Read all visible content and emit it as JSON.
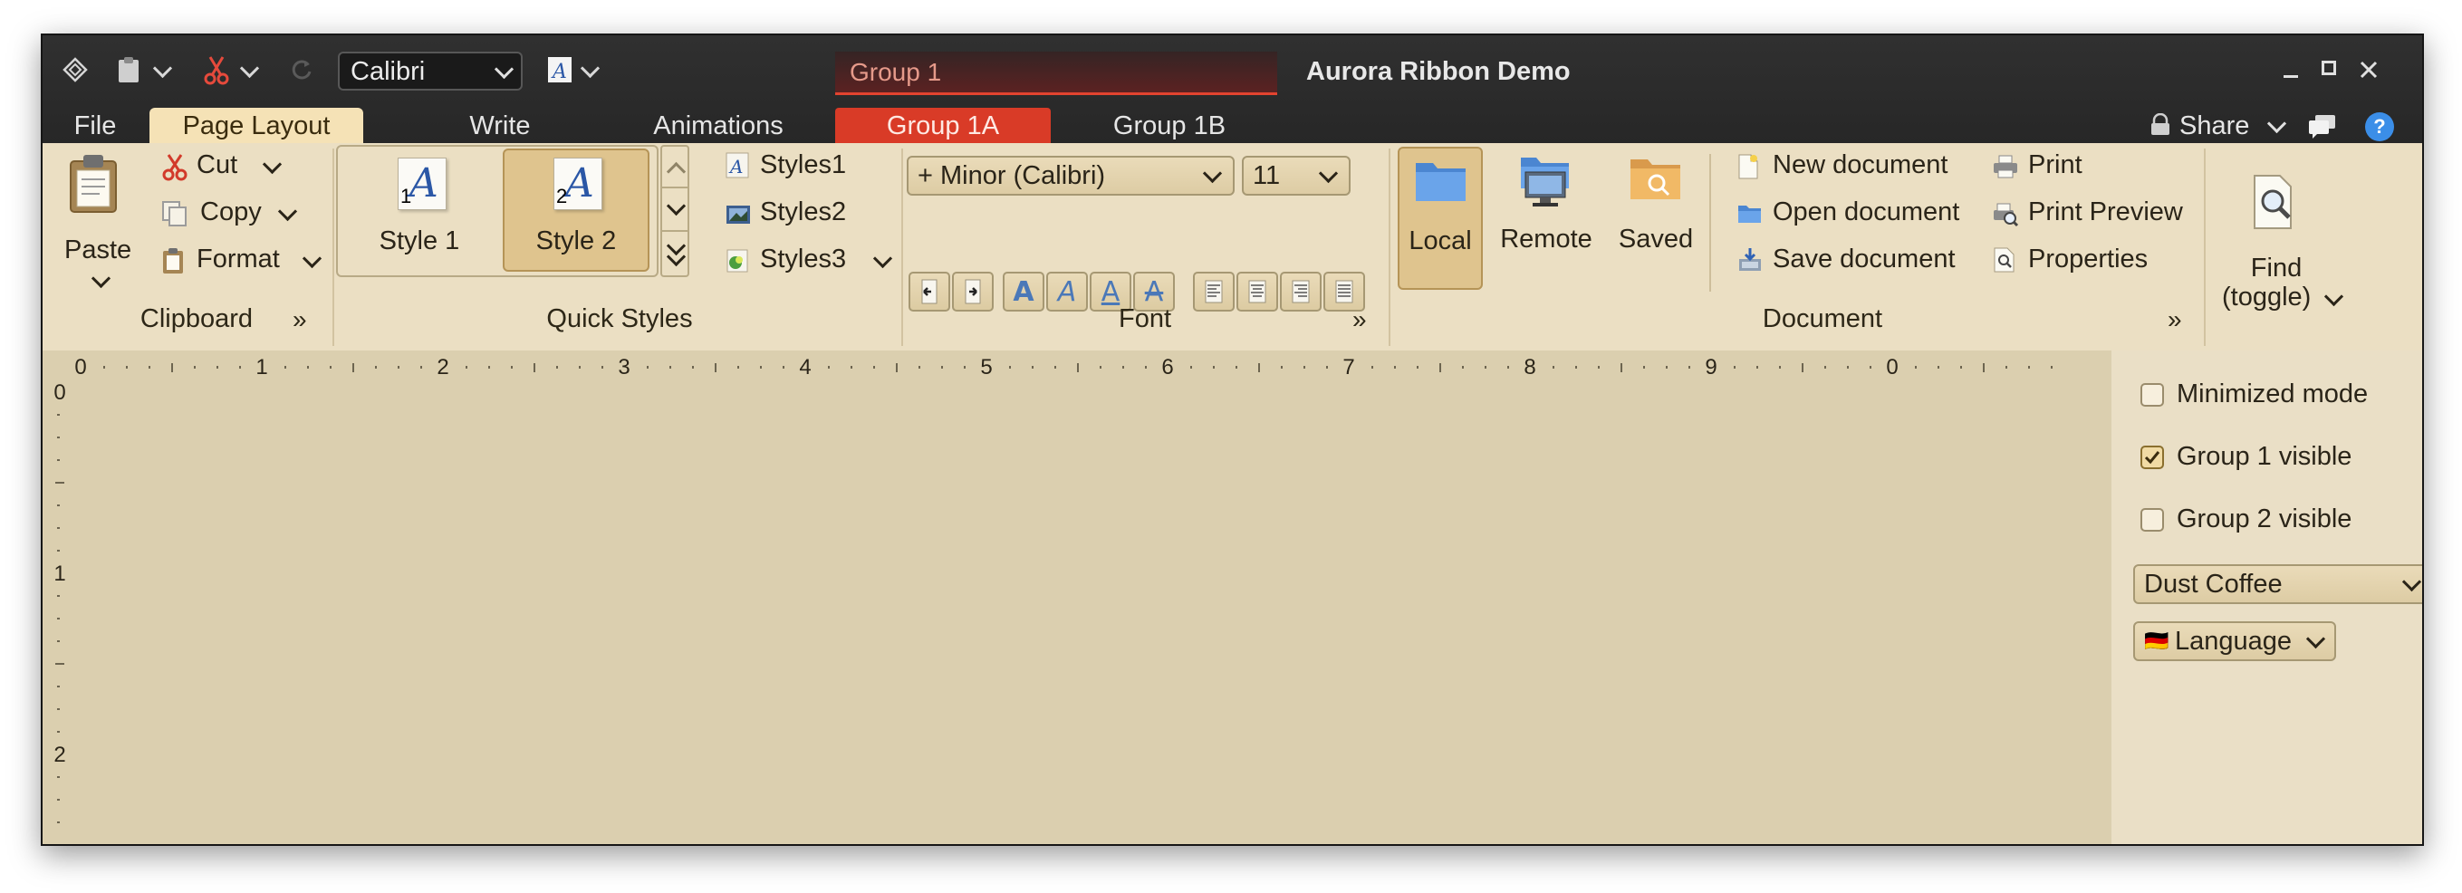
{
  "window": {
    "title": "Aurora Ribbon Demo"
  },
  "quick_access": {
    "font_family": "Calibri",
    "icons": [
      "ribbon-diamond-icon",
      "paste-icon",
      "cut-icon",
      "refresh-icon",
      "font-style-icon"
    ]
  },
  "contextual_group": {
    "name": "Group 1"
  },
  "tabs": [
    "File",
    "Page Layout",
    "Write",
    "Animations",
    "Group 1A",
    "Group 1B"
  ],
  "active_tab": "Page Layout",
  "top_right": {
    "share_label": "Share"
  },
  "ribbon": {
    "clipboard": {
      "group_label": "Clipboard",
      "paste_label": "Paste",
      "cut_label": "Cut",
      "copy_label": "Copy",
      "format_label": "Format"
    },
    "quick_styles": {
      "group_label": "Quick Styles",
      "gallery": [
        {
          "label": "Style 1",
          "num": "1",
          "glyph": "A"
        },
        {
          "label": "Style 2",
          "num": "2",
          "glyph": "A",
          "selected": true
        }
      ],
      "list": [
        "Styles1",
        "Styles2",
        "Styles3"
      ]
    },
    "font": {
      "group_label": "Font",
      "font_name": "+ Minor (Calibri)",
      "font_size": "11",
      "style_glyph": "A"
    },
    "document": {
      "group_label": "Document",
      "locations": [
        "Local",
        "Remote",
        "Saved"
      ],
      "actions": [
        "New document",
        "Open document",
        "Save document"
      ],
      "print_actions": [
        "Print",
        "Print Preview",
        "Properties"
      ]
    },
    "find": {
      "label1": "Find",
      "label2": "(toggle)"
    }
  },
  "ruler": {
    "horizontal": [
      "0",
      "1",
      "2",
      "3",
      "4",
      "5",
      "6",
      "7",
      "8",
      "9",
      "0"
    ],
    "vertical": [
      "0",
      "1",
      "2"
    ]
  },
  "side_panel": {
    "checks": [
      {
        "label": "Minimized mode",
        "checked": false
      },
      {
        "label": "Group 1 visible",
        "checked": true
      },
      {
        "label": "Group 2 visible",
        "checked": false
      }
    ],
    "skin": "Dust Coffee",
    "language": "Language",
    "language_flag": "🇩🇪"
  },
  "colors": {
    "title_bar": "#2b2b2b",
    "ribbon_bg": "#ebdfc3",
    "workspace_bg": "#dbcfaf",
    "accent_selected": "#dfc48e",
    "contextual_tab": "#d93b27"
  }
}
